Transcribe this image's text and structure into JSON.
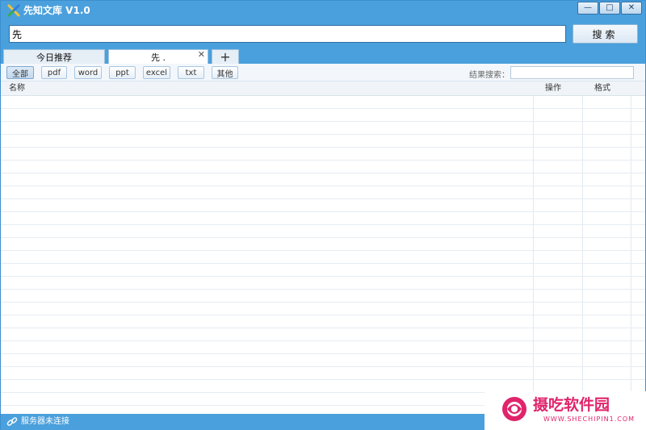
{
  "app": {
    "title": "先知文库 V1.0"
  },
  "window_controls": {
    "minimize": "—",
    "maximize": "□",
    "close": "✕"
  },
  "search": {
    "value": "先",
    "button_label": "搜索"
  },
  "tabs": [
    {
      "label": "今日推荐"
    },
    {
      "label": "先 .",
      "close": "✕"
    }
  ],
  "add_tab": {
    "label": "+"
  },
  "filters": [
    "全部",
    "pdf",
    "word",
    "ppt",
    "excel",
    "txt",
    "其他"
  ],
  "filter_selected": "全部",
  "result_search": {
    "label": "结果搜索：",
    "value": ""
  },
  "table": {
    "columns": [
      "名称",
      "操作",
      "格式"
    ],
    "rows": []
  },
  "status": {
    "text": "服务器未连接",
    "icon": "link-icon"
  },
  "watermark": {
    "title": "摄吃软件园",
    "sub": "WWW.SHECHIPIN1.COM"
  },
  "colors": {
    "accent": "#4aa0dc",
    "watermark": "#e0246b"
  }
}
